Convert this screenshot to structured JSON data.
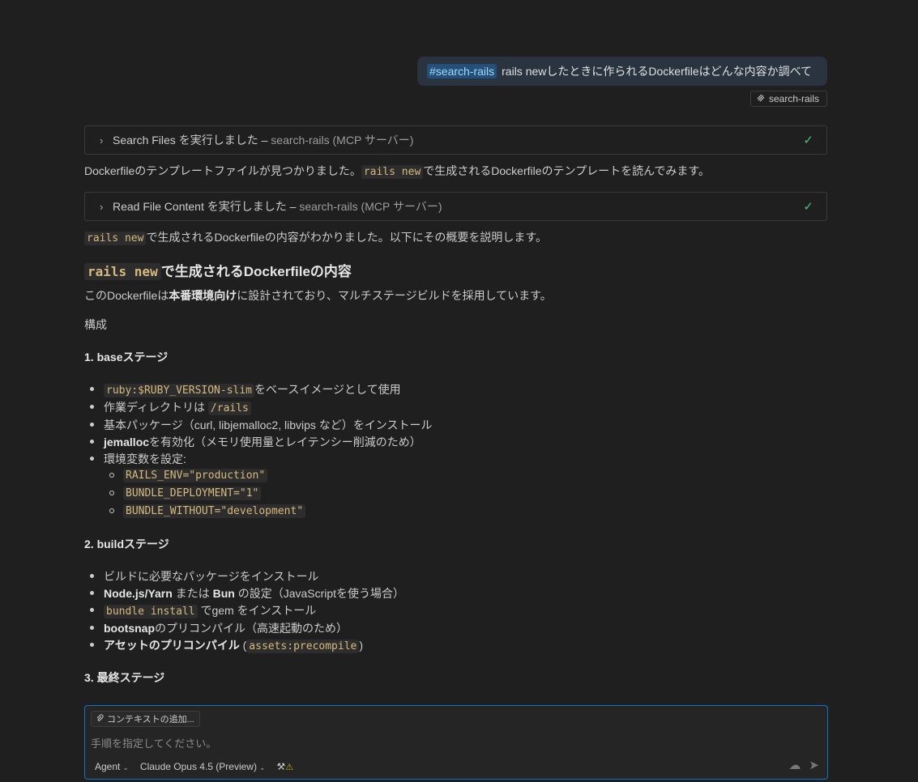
{
  "user_message": {
    "tag": "#search-rails",
    "text": "rails newしたときに作られるDockerfileはどんな内容か調べて",
    "reference_chip": "search-rails"
  },
  "tool_calls": [
    {
      "name": "Search Files",
      "suffix": " を実行しました – ",
      "server": "search-rails (MCP サーバー)"
    },
    {
      "name": "Read File Content",
      "suffix": " を実行しました – ",
      "server": "search-rails (MCP サーバー)"
    }
  ],
  "response": {
    "p1_before": "Dockerfileのテンプレートファイルが見つかりました。",
    "p1_code": "rails new",
    "p1_after": "で生成されるDockerfileのテンプレートを読んでみます。",
    "p2_code": "rails new",
    "p2_after": "で生成されるDockerfileの内容がわかりました。以下にその概要を説明します。",
    "h2_code": "rails new",
    "h2_after": "で生成されるDockerfileの内容",
    "intro_before": "このDockerfileは",
    "intro_bold": "本番環境向け",
    "intro_after": "に設計されており、マルチステージビルドを採用しています。",
    "section_label": "構成",
    "stage1_title": "1. baseステージ",
    "stage1": {
      "i1_code": "ruby:$RUBY_VERSION-slim",
      "i1_text": "をベースイメージとして使用",
      "i2_text": "作業ディレクトリは ",
      "i2_code": "/rails",
      "i3_text": "基本パッケージ（curl, libjemalloc2, libvips など）をインストール",
      "i4_bold": "jemalloc",
      "i4_text": "を有効化（メモリ使用量とレイテンシー削減のため）",
      "i5_text": "環境変数を設定:",
      "env": [
        "RAILS_ENV=\"production\"",
        "BUNDLE_DEPLOYMENT=\"1\"",
        "BUNDLE_WITHOUT=\"development\""
      ]
    },
    "stage2_title": "2. buildステージ",
    "stage2": {
      "i1_text": "ビルドに必要なパッケージをインストール",
      "i2_bold1": "Node.js/Yarn",
      "i2_mid": " または ",
      "i2_bold2": "Bun",
      "i2_text": " の設定（JavaScriptを使う場合）",
      "i3_code": "bundle install",
      "i3_text": " でgem をインストール",
      "i4_bold": "bootsnap",
      "i4_text": "のプリコンパイル（高速起動のため）",
      "i5_bold": "アセットのプリコンパイル",
      "i5_open": " (",
      "i5_code": "assets:precompile",
      "i5_close": ")"
    },
    "stage3_title": "3. 最終ステージ"
  },
  "input": {
    "add_context": "コンテキストの追加...",
    "placeholder": "手順を指定してください。",
    "mode": "Agent",
    "model": "Claude Opus 4.5 (Preview)"
  },
  "colors": {
    "accent": "#0e74d1",
    "check": "#4ec27a",
    "code": "#d7ba7d"
  }
}
